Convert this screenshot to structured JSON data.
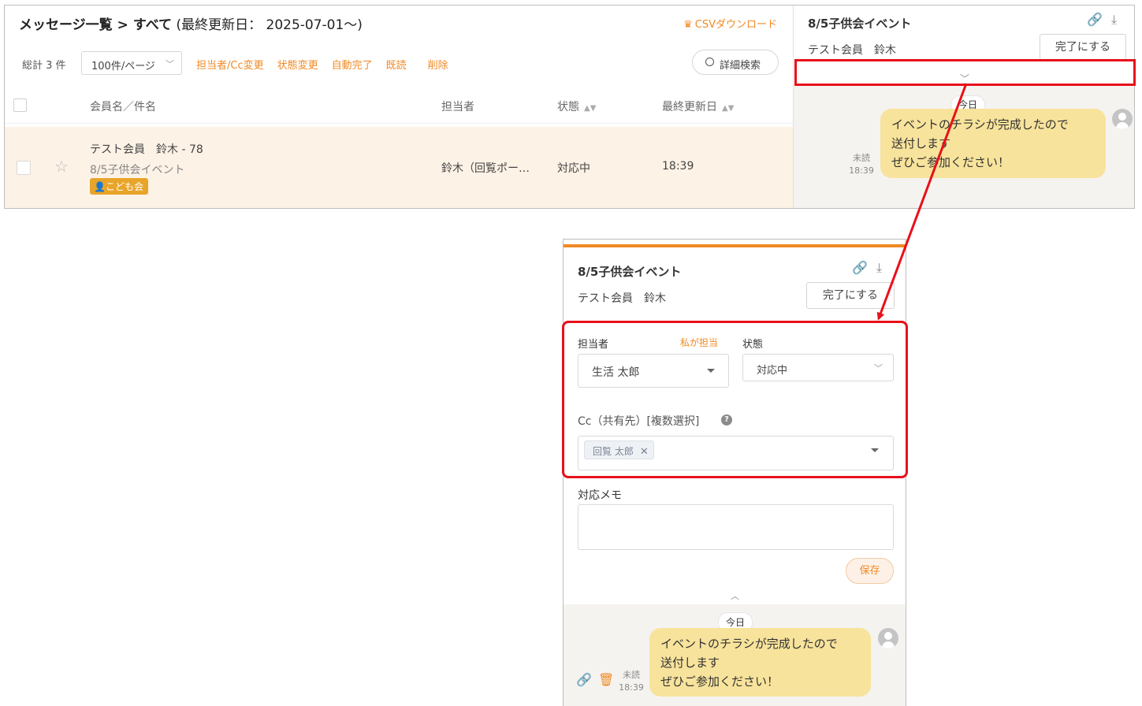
{
  "list": {
    "title_main": "メッセージ一覧",
    "separator": ">",
    "title_filter": "すべて",
    "title_note": "(最終更新日： 2025-07-01〜)",
    "csv_label": "CSVダウンロード",
    "total": "総計 3 件",
    "per_page": "100件/ページ",
    "actions": [
      "担当者/Cc変更",
      "状態変更",
      "自動完了",
      "既読",
      "削除"
    ],
    "advanced_search": "詳細検索",
    "columns": {
      "member": "会員名／件名",
      "assignee": "担当者",
      "status": "状態",
      "updated": "最終更新日"
    },
    "rows": [
      {
        "member": "テスト会員　鈴木 - 78",
        "subject": "8/5子供会イベント",
        "tag": "こども会",
        "assignee": "鈴木（回覧ポー…",
        "status": "対応中",
        "updated": "18:39"
      }
    ]
  },
  "detail": {
    "title": "8/5子供会イベント",
    "member": "テスト会員　鈴木",
    "done_button": "完了にする",
    "chat": {
      "date_label": "今日",
      "message_lines": [
        "イベントのチラシが完成したので",
        "送付します",
        "ぜひご参加ください！"
      ],
      "unread": "未読",
      "time": "18:39"
    }
  },
  "zoom": {
    "title": "8/5子供会イベント",
    "member": "テスト会員　鈴木",
    "done_button": "完了にする",
    "assignee_label": "担当者",
    "assign_me": "私が担当",
    "assignee_value": "生活 太郎",
    "status_label": "状態",
    "status_value": "対応中",
    "cc_label": "Cc（共有先）[複数選択]",
    "cc_chip": "回覧 太郎",
    "memo_label": "対応メモ",
    "save_button": "保存",
    "chat": {
      "date_label": "今日",
      "message_lines": [
        "イベントのチラシが完成したので",
        "送付します",
        "ぜひご参加ください！"
      ],
      "unread": "未読",
      "time": "18:39"
    }
  },
  "colors": {
    "accent": "#f08a24",
    "highlight": "#e8101a",
    "bubble": "#f7e39b",
    "row_selected": "#fdf2e6"
  },
  "icons": [
    "crown-icon",
    "search-icon",
    "star-icon",
    "user-icon",
    "link-icon",
    "download-icon",
    "help-icon",
    "trash-icon"
  ]
}
